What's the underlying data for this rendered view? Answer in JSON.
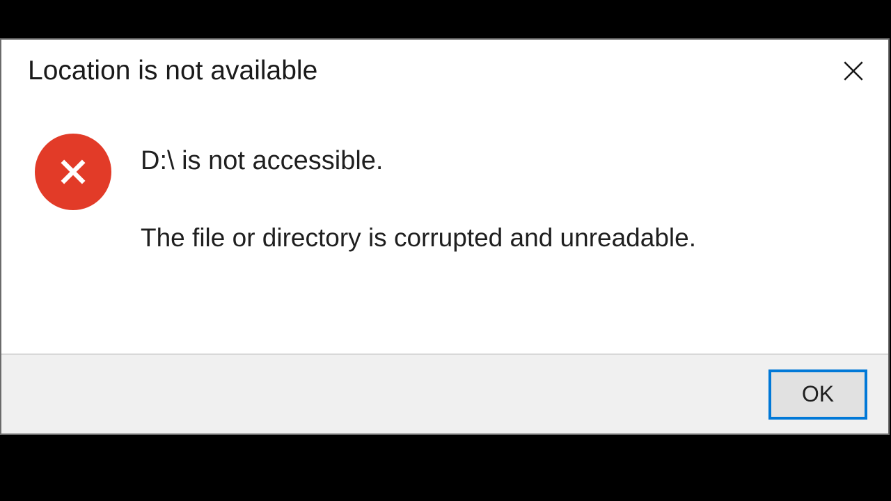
{
  "dialog": {
    "title": "Location is not available",
    "message_primary": "D:\\ is not accessible.",
    "message_secondary": "The file or directory is corrupted and unreadable.",
    "ok_label": "OK"
  },
  "colors": {
    "error_icon": "#e23b28",
    "button_focus_border": "#0078d7",
    "button_bg": "#e1e1e1",
    "button_bar_bg": "#f0f0f0"
  }
}
